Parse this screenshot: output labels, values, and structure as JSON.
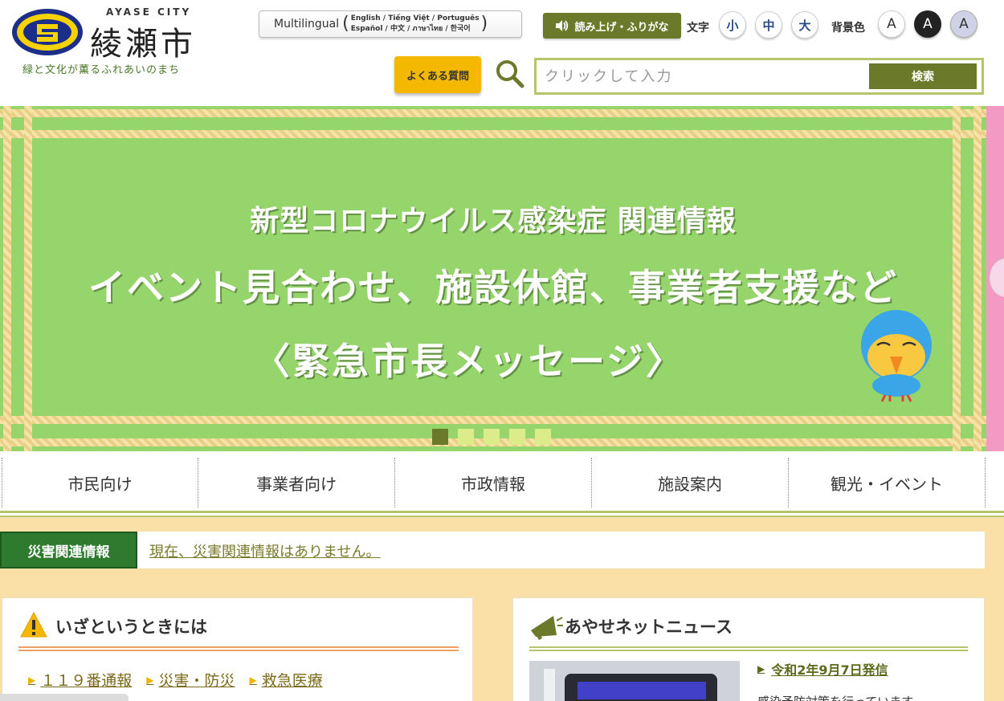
{
  "header": {
    "city_en": "AYASE CITY",
    "city_jp": "綾瀬市",
    "tagline": "緑と文化が薫るふれあいのまち",
    "multilingual_label": "Multilingual",
    "languages_line1": "English / Tiếng Việt / Português",
    "languages_line2": "Español / 中文 / ภาษาไทย / 한국어",
    "read_aloud_label": "読み上げ・ふりがな",
    "text_size_label": "文字",
    "size_small": "小",
    "size_medium": "中",
    "size_large": "大",
    "bg_color_label": "背景色",
    "bg_option": "A",
    "faq_label": "よくある質問",
    "search_placeholder": "クリックして入力",
    "search_button": "検索"
  },
  "banner": {
    "line1": "新型コロナウイルス感染症 関連情報",
    "line2": "イベント見合わせ、施設休館、事業者支援など",
    "line3": "〈緊急市長メッセージ〉",
    "slide_count": 5,
    "active_slide": 1
  },
  "nav": {
    "items": [
      "市民向け",
      "事業者向け",
      "市政情報",
      "施設案内",
      "観光・イベント"
    ]
  },
  "disaster": {
    "label": "災害関連情報",
    "text": "現在、災害関連情報はありません。"
  },
  "emergency": {
    "title": "いざというときには",
    "links": [
      "１１９番通報",
      "災害・防災",
      "救急医療"
    ]
  },
  "news": {
    "title": "あやせネットニュース",
    "date": "令和2年9月7日発信",
    "body": "感染予防対策を行っています"
  },
  "colors": {
    "accent_olive": "#6b7a2a",
    "banner_green": "#96d46c",
    "faq_yellow": "#f5b800",
    "disaster_green": "#2e7a2e",
    "lower_bg": "#fadfa6"
  }
}
